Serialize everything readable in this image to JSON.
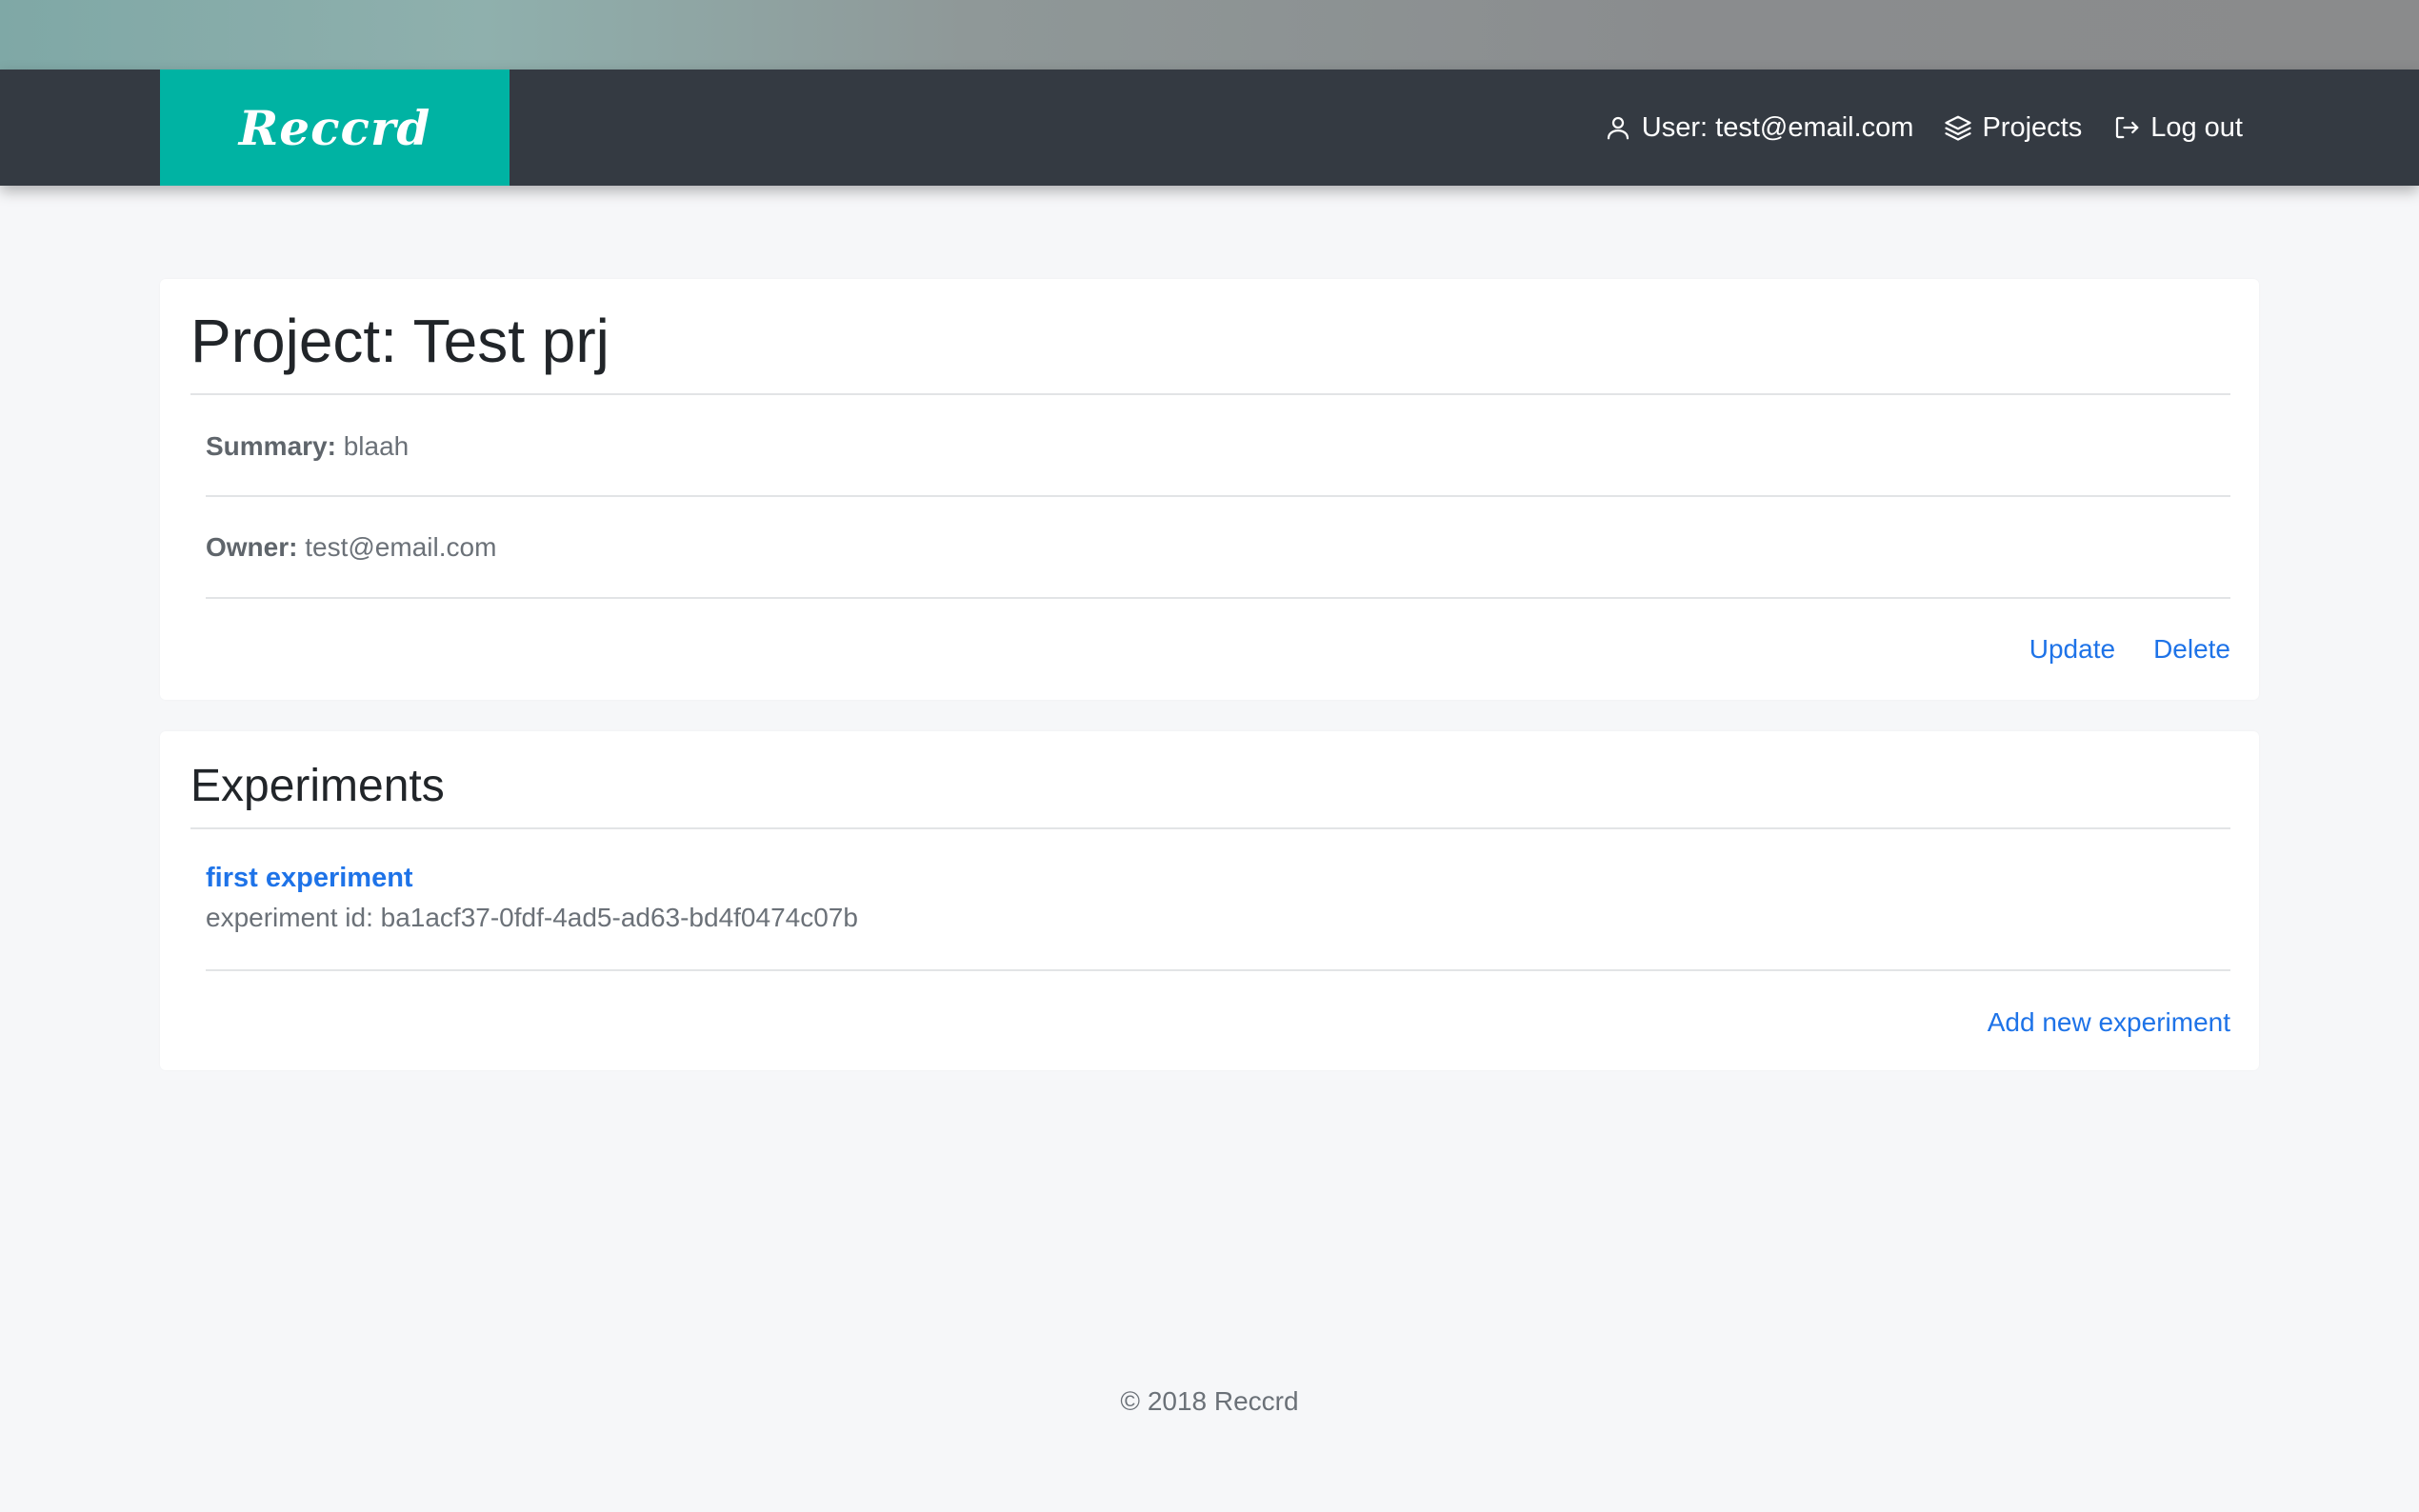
{
  "brand": {
    "name": "Reccrd",
    "color": "#00b3a3"
  },
  "nav": {
    "user_label": "User: test@email.com",
    "projects_label": "Projects",
    "logout_label": "Log out"
  },
  "project": {
    "title": "Project: Test prj",
    "summary_label": "Summary:",
    "summary_value": "blaah",
    "owner_label": "Owner:",
    "owner_value": "test@email.com",
    "update_label": "Update",
    "delete_label": "Delete"
  },
  "experiments": {
    "heading": "Experiments",
    "items": [
      {
        "name": "first experiment",
        "id_text": "experiment id: ba1acf37-0fdf-4ad5-ad63-bd4f0474c07b"
      }
    ],
    "add_label": "Add new experiment"
  },
  "footer": {
    "text": "© 2018 Reccrd"
  },
  "colors": {
    "navbar": "#343a42",
    "link": "#1e73e8",
    "background": "#f6f7f9"
  }
}
